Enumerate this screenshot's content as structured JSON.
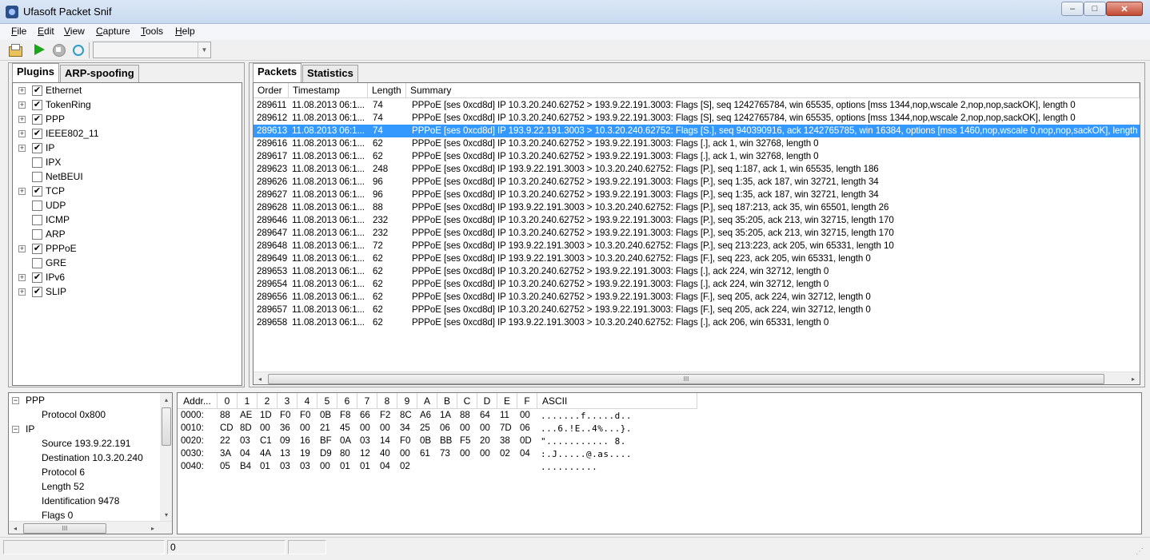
{
  "window": {
    "title": "Ufasoft Packet Snif",
    "min": "–",
    "max": "□",
    "close": "✕"
  },
  "menu": [
    "File",
    "Edit",
    "View",
    "Capture",
    "Tools",
    "Help"
  ],
  "toolbar": {
    "icons": [
      "open-folder-icon",
      "play-icon",
      "stop-icon",
      "refresh-icon"
    ],
    "interface": ""
  },
  "left_tabs": [
    "Plugins",
    "ARP-spoofing"
  ],
  "plugins": [
    {
      "label": "Ethernet",
      "expand": "+",
      "checked": "✔"
    },
    {
      "label": "TokenRing",
      "expand": "+",
      "checked": "✔"
    },
    {
      "label": "PPP",
      "expand": "+",
      "checked": "✔"
    },
    {
      "label": "IEEE802_11",
      "expand": "+",
      "checked": "✔"
    },
    {
      "label": "IP",
      "expand": "+",
      "checked": "✔"
    },
    {
      "label": "IPX",
      "expand": "",
      "checked": ""
    },
    {
      "label": "NetBEUI",
      "expand": "",
      "checked": ""
    },
    {
      "label": "TCP",
      "expand": "+",
      "checked": "✔"
    },
    {
      "label": "UDP",
      "expand": "",
      "checked": ""
    },
    {
      "label": "ICMP",
      "expand": "",
      "checked": ""
    },
    {
      "label": "ARP",
      "expand": "",
      "checked": ""
    },
    {
      "label": "PPPoE",
      "expand": "+",
      "checked": "✔"
    },
    {
      "label": "GRE",
      "expand": "",
      "checked": ""
    },
    {
      "label": "IPv6",
      "expand": "+",
      "checked": "✔"
    },
    {
      "label": "SLIP",
      "expand": "+",
      "checked": "✔"
    }
  ],
  "right_tabs": [
    "Packets",
    "Statistics"
  ],
  "packets": {
    "columns": [
      "Order",
      "Timestamp",
      "Length",
      "Summary"
    ],
    "rows": [
      {
        "order": "289611",
        "ts": "11.08.2013 06:1...",
        "len": "74",
        "summary": "PPPoE  [ses 0xcd8d] IP 10.3.20.240.62752 > 193.9.22.191.3003: Flags [S], seq 1242765784, win 65535, options [mss 1344,nop,wscale 2,nop,nop,sackOK], length 0"
      },
      {
        "order": "289612",
        "ts": "11.08.2013 06:1...",
        "len": "74",
        "summary": "PPPoE  [ses 0xcd8d] IP 10.3.20.240.62752 > 193.9.22.191.3003: Flags [S], seq 1242765784, win 65535, options [mss 1344,nop,wscale 2,nop,nop,sackOK], length 0"
      },
      {
        "order": "289613",
        "ts": "11.08.2013 06:1...",
        "len": "74",
        "summary": "PPPoE  [ses 0xcd8d] IP 193.9.22.191.3003 > 10.3.20.240.62752: Flags [S.], seq 940390916, ack 1242765785, win 16384, options [mss 1460,nop,wscale 0,nop,nop,sackOK], length 0"
      },
      {
        "order": "289616",
        "ts": "11.08.2013 06:1...",
        "len": "62",
        "summary": "PPPoE  [ses 0xcd8d] IP 10.3.20.240.62752 > 193.9.22.191.3003: Flags [.], ack 1, win 32768, length 0"
      },
      {
        "order": "289617",
        "ts": "11.08.2013 06:1...",
        "len": "62",
        "summary": "PPPoE  [ses 0xcd8d] IP 10.3.20.240.62752 > 193.9.22.191.3003: Flags [.], ack 1, win 32768, length 0"
      },
      {
        "order": "289623",
        "ts": "11.08.2013 06:1...",
        "len": "248",
        "summary": "PPPoE  [ses 0xcd8d] IP 193.9.22.191.3003 > 10.3.20.240.62752: Flags [P.], seq 1:187, ack 1, win 65535, length 186"
      },
      {
        "order": "289626",
        "ts": "11.08.2013 06:1...",
        "len": "96",
        "summary": "PPPoE  [ses 0xcd8d] IP 10.3.20.240.62752 > 193.9.22.191.3003: Flags [P.], seq 1:35, ack 187, win 32721, length 34"
      },
      {
        "order": "289627",
        "ts": "11.08.2013 06:1...",
        "len": "96",
        "summary": "PPPoE  [ses 0xcd8d] IP 10.3.20.240.62752 > 193.9.22.191.3003: Flags [P.], seq 1:35, ack 187, win 32721, length 34"
      },
      {
        "order": "289628",
        "ts": "11.08.2013 06:1...",
        "len": "88",
        "summary": "PPPoE  [ses 0xcd8d] IP 193.9.22.191.3003 > 10.3.20.240.62752: Flags [P.], seq 187:213, ack 35, win 65501, length 26"
      },
      {
        "order": "289646",
        "ts": "11.08.2013 06:1...",
        "len": "232",
        "summary": "PPPoE  [ses 0xcd8d] IP 10.3.20.240.62752 > 193.9.22.191.3003: Flags [P.], seq 35:205, ack 213, win 32715, length 170"
      },
      {
        "order": "289647",
        "ts": "11.08.2013 06:1...",
        "len": "232",
        "summary": "PPPoE  [ses 0xcd8d] IP 10.3.20.240.62752 > 193.9.22.191.3003: Flags [P.], seq 35:205, ack 213, win 32715, length 170"
      },
      {
        "order": "289648",
        "ts": "11.08.2013 06:1...",
        "len": "72",
        "summary": "PPPoE  [ses 0xcd8d] IP 193.9.22.191.3003 > 10.3.20.240.62752: Flags [P.], seq 213:223, ack 205, win 65331, length 10"
      },
      {
        "order": "289649",
        "ts": "11.08.2013 06:1...",
        "len": "62",
        "summary": "PPPoE  [ses 0xcd8d] IP 193.9.22.191.3003 > 10.3.20.240.62752: Flags [F.], seq 223, ack 205, win 65331, length 0"
      },
      {
        "order": "289653",
        "ts": "11.08.2013 06:1...",
        "len": "62",
        "summary": "PPPoE  [ses 0xcd8d] IP 10.3.20.240.62752 > 193.9.22.191.3003: Flags [.], ack 224, win 32712, length 0"
      },
      {
        "order": "289654",
        "ts": "11.08.2013 06:1...",
        "len": "62",
        "summary": "PPPoE  [ses 0xcd8d] IP 10.3.20.240.62752 > 193.9.22.191.3003: Flags [.], ack 224, win 32712, length 0"
      },
      {
        "order": "289656",
        "ts": "11.08.2013 06:1...",
        "len": "62",
        "summary": "PPPoE  [ses 0xcd8d] IP 10.3.20.240.62752 > 193.9.22.191.3003: Flags [F.], seq 205, ack 224, win 32712, length 0"
      },
      {
        "order": "289657",
        "ts": "11.08.2013 06:1...",
        "len": "62",
        "summary": "PPPoE  [ses 0xcd8d] IP 10.3.20.240.62752 > 193.9.22.191.3003: Flags [F.], seq 205, ack 224, win 32712, length 0"
      },
      {
        "order": "289658",
        "ts": "11.08.2013 06:1...",
        "len": "62",
        "summary": "PPPoE  [ses 0xcd8d] IP 193.9.22.191.3003 > 10.3.20.240.62752: Flags [.], ack 206, win 65331, length 0"
      }
    ],
    "selected_order": "289613"
  },
  "decode_tree": [
    {
      "label": "PPP",
      "level": 0,
      "expand": "−"
    },
    {
      "label": "Protocol 0x800",
      "level": 1,
      "expand": ""
    },
    {
      "label": "IP",
      "level": 0,
      "expand": "−"
    },
    {
      "label": "Source 193.9.22.191",
      "level": 1,
      "expand": ""
    },
    {
      "label": "Destination 10.3.20.240",
      "level": 1,
      "expand": ""
    },
    {
      "label": "Protocol 6",
      "level": 1,
      "expand": ""
    },
    {
      "label": "Length 52",
      "level": 1,
      "expand": ""
    },
    {
      "label": "Identification 9478",
      "level": 1,
      "expand": ""
    },
    {
      "label": "Flags 0",
      "level": 1,
      "expand": ""
    }
  ],
  "hex": {
    "headers": [
      "Addr...",
      "0",
      "1",
      "2",
      "3",
      "4",
      "5",
      "6",
      "7",
      "8",
      "9",
      "A",
      "B",
      "C",
      "D",
      "E",
      "F",
      "ASCII"
    ],
    "lines": [
      {
        "addr": "0000:",
        "bytes": [
          "88",
          "AE",
          "1D",
          "F0",
          "F0",
          "0B",
          "F8",
          "66",
          "F2",
          "8C",
          "A6",
          "1A",
          "88",
          "64",
          "11",
          "00"
        ],
        "ascii": ".......f.....d.."
      },
      {
        "addr": "0010:",
        "bytes": [
          "CD",
          "8D",
          "00",
          "36",
          "00",
          "21",
          "45",
          "00",
          "00",
          "34",
          "25",
          "06",
          "00",
          "00",
          "7D",
          "06"
        ],
        "ascii": "...6.!E..4%...}."
      },
      {
        "addr": "0020:",
        "bytes": [
          "22",
          "03",
          "C1",
          "09",
          "16",
          "BF",
          "0A",
          "03",
          "14",
          "F0",
          "0B",
          "BB",
          "F5",
          "20",
          "38",
          "0D"
        ],
        "ascii": "\"........... 8."
      },
      {
        "addr": "0030:",
        "bytes": [
          "3A",
          "04",
          "4A",
          "13",
          "19",
          "D9",
          "80",
          "12",
          "40",
          "00",
          "61",
          "73",
          "00",
          "00",
          "02",
          "04"
        ],
        "ascii": ":.J.....@.as...."
      },
      {
        "addr": "0040:",
        "bytes": [
          "05",
          "B4",
          "01",
          "03",
          "03",
          "00",
          "01",
          "01",
          "04",
          "02",
          "",
          "",
          "",
          "",
          "",
          ""
        ],
        "ascii": ".........."
      }
    ]
  },
  "scroll": {
    "thumb_grip": "III",
    "left": "◂",
    "right": "▸",
    "up": "▴",
    "down": "▾"
  },
  "status": [
    "",
    "0",
    ""
  ]
}
